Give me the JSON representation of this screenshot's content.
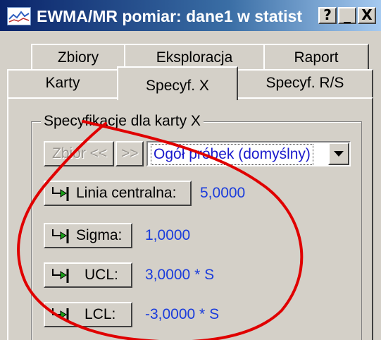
{
  "window": {
    "title": "EWMA/MR pomiar: dane1 w statist",
    "help_label": "?",
    "minimize_label": "_",
    "close_label": "X"
  },
  "tabs": {
    "row1": [
      "Zbiory",
      "Eksploracja",
      "Raport"
    ],
    "row2": [
      "Karty",
      "Specyf. X",
      "Specyf. R/S"
    ],
    "active": "Specyf. X"
  },
  "group": {
    "title": "Specyfikacje dla karty X",
    "prev_button": "Zbiór <<",
    "next_button": ">>",
    "combo_value": "Ogół próbek (domyślny)"
  },
  "rows": [
    {
      "label": "Linia centralna:",
      "value": "5,0000"
    },
    {
      "label": "Sigma:",
      "value": "1,0000"
    },
    {
      "label": "UCL:",
      "value": "3,0000 * S"
    },
    {
      "label": "LCL:",
      "value": "-3,0000 * S"
    }
  ],
  "colors": {
    "title_bar": "#0a246a",
    "value_text": "#1a3cdc",
    "annotation": "#e00000",
    "face": "#d4d0c8"
  },
  "icons": {
    "app": "chart-icon",
    "row_button": "arrow-into-bracket-icon",
    "combo": "triangle-down-icon"
  }
}
